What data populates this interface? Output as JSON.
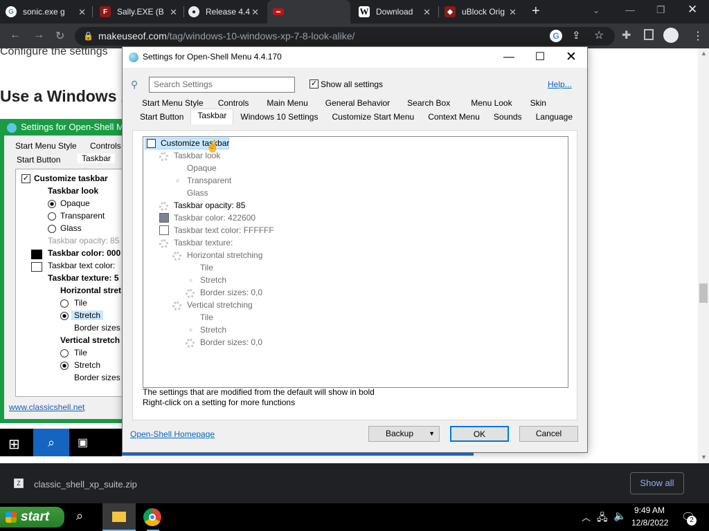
{
  "browser": {
    "tabs": [
      {
        "title": "sonic.exe g",
        "icon": "google-icon"
      },
      {
        "title": "Sally.EXE (B",
        "icon": "fandom-icon"
      },
      {
        "title": "Release 4.4",
        "icon": "github-icon"
      },
      {
        "title": "",
        "icon": "tab-favicon-icon"
      },
      {
        "title": "Download",
        "icon": "w-icon"
      },
      {
        "title": "uBlock Orig",
        "icon": "puzzle-icon"
      }
    ],
    "new_tab": "+",
    "url_domain": "makeuseof.com",
    "url_path": "/tag/windows-10-windows-xp-7-8-look-alike/"
  },
  "article": {
    "line1": "Configure the settings",
    "heading": "Use a Windows X",
    "link": "www.classicshell.net",
    "image_window_title": "Settings for Open-Shell Men",
    "image_tabs_row1": [
      "Start Menu Style",
      "Controls"
    ],
    "image_tabs_row2": [
      "Start Button",
      "Taskbar"
    ],
    "image_tree": [
      "Customize taskbar",
      "Taskbar look",
      "Opaque",
      "Transparent",
      "Glass",
      "Taskbar opacity: 85",
      "Taskbar color: 000",
      "Taskbar text color:",
      "Taskbar texture: 5",
      "Horizontal stret",
      "Tile",
      "Stretch",
      "Border sizes",
      "Vertical stretch",
      "Tile",
      "Stretch",
      "Border sizes"
    ]
  },
  "dialog": {
    "title": "Settings for Open-Shell Menu 4.4.170",
    "search_placeholder": "Search Settings",
    "show_all_label": "Show all settings",
    "help_link": "Help...",
    "tabs_row1": [
      "Start Menu Style",
      "Controls",
      "Main Menu",
      "General Behavior",
      "Search Box",
      "Menu Look",
      "Skin"
    ],
    "tabs_row2": [
      "Start Button",
      "Taskbar",
      "Windows 10 Settings",
      "Customize Start Menu",
      "Context Menu",
      "Sounds",
      "Language"
    ],
    "selected_tab": "Taskbar",
    "tree": {
      "customize_taskbar": "Customize taskbar",
      "taskbar_look": "Taskbar look",
      "opaque": "Opaque",
      "transparent": "Transparent",
      "glass": "Glass",
      "opacity": "Taskbar opacity: 85",
      "color": "Taskbar color: 422600",
      "text_color": "Taskbar text color: FFFFFF",
      "texture": "Taskbar texture:",
      "horizontal": "Horizontal stretching",
      "h_tile": "Tile",
      "h_stretch": "Stretch",
      "h_border": "Border sizes: 0,0",
      "vertical": "Vertical stretching",
      "v_tile": "Tile",
      "v_stretch": "Stretch",
      "v_border": "Border sizes: 0,0"
    },
    "taskbar_color": "#7b8490",
    "note1": "The settings that are modified from the default will show in bold",
    "note2": "Right-click on a setting for more functions",
    "homepage_link": "Open-Shell Homepage",
    "backup_button": "Backup",
    "ok_button": "OK",
    "cancel_button": "Cancel"
  },
  "downloads": {
    "file": "classic_shell_xp_suite.zip",
    "show_all": "Show all"
  },
  "taskbar": {
    "start_label": "start",
    "time": "9:49 AM",
    "date": "12/8/2022",
    "notifications": "2"
  },
  "colors": {
    "accent": "#0066cc",
    "start_green": "#3c9a3c"
  }
}
